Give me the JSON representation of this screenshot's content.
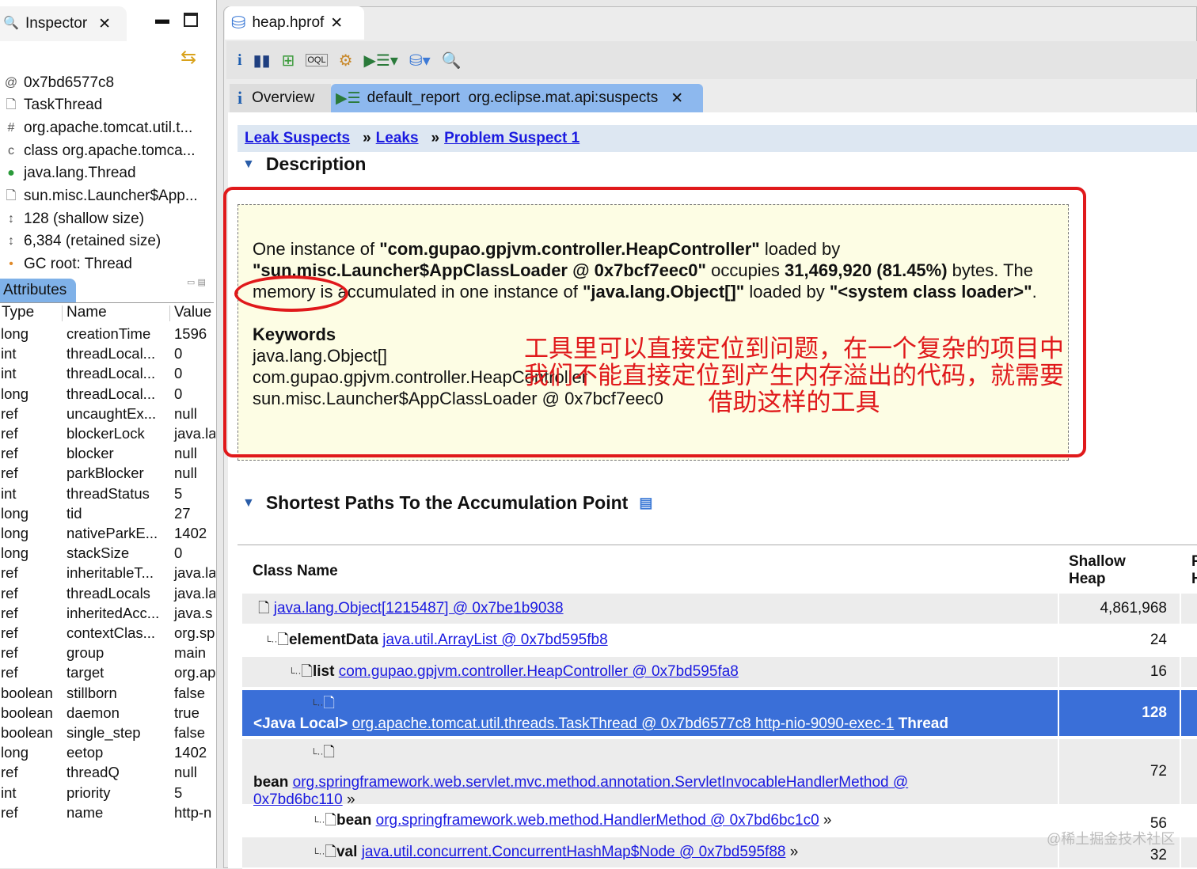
{
  "inspector": {
    "tab_label": "Inspector",
    "items": [
      {
        "icon": "at-icon",
        "text": "0x7bd6577c8"
      },
      {
        "icon": "object-icon",
        "text": "TaskThread"
      },
      {
        "icon": "package-icon",
        "text": "org.apache.tomcat.util.t..."
      },
      {
        "icon": "class-icon",
        "text": "class org.apache.tomca..."
      },
      {
        "icon": "class-static-icon",
        "text": "java.lang.Thread"
      },
      {
        "icon": "classloader-icon",
        "text": "sun.misc.Launcher$App..."
      },
      {
        "icon": "size-icon",
        "text": "128 (shallow size)"
      },
      {
        "icon": "size-icon",
        "text": "6,384 (retained size)"
      },
      {
        "icon": "gc-root-icon",
        "text": "GC root: Thread"
      }
    ],
    "attributes_tab": "Attributes",
    "columns": [
      "Type",
      "Name",
      "Value"
    ],
    "rows": [
      [
        "long",
        "creationTime",
        "1596"
      ],
      [
        "int",
        "threadLocal...",
        "0"
      ],
      [
        "int",
        "threadLocal...",
        "0"
      ],
      [
        "long",
        "threadLocal...",
        "0"
      ],
      [
        "ref",
        "uncaughtEx...",
        "null"
      ],
      [
        "ref",
        "blockerLock",
        "java.la"
      ],
      [
        "ref",
        "blocker",
        "null"
      ],
      [
        "ref",
        "parkBlocker",
        "null"
      ],
      [
        "int",
        "threadStatus",
        "5"
      ],
      [
        "long",
        "tid",
        "27"
      ],
      [
        "long",
        "nativeParkE...",
        "1402"
      ],
      [
        "long",
        "stackSize",
        "0"
      ],
      [
        "ref",
        "inheritableT...",
        "java.la"
      ],
      [
        "ref",
        "threadLocals",
        "java.la"
      ],
      [
        "ref",
        "inheritedAcc...",
        "java.s"
      ],
      [
        "ref",
        "contextClas...",
        "org.sp"
      ],
      [
        "ref",
        "group",
        "main"
      ],
      [
        "ref",
        "target",
        "org.ap"
      ],
      [
        "boolean",
        "stillborn",
        "false"
      ],
      [
        "boolean",
        "daemon",
        "true"
      ],
      [
        "boolean",
        "single_step",
        "false"
      ],
      [
        "long",
        "eetop",
        "1402"
      ],
      [
        "ref",
        "threadQ",
        "null"
      ],
      [
        "int",
        "priority",
        "5"
      ],
      [
        "ref",
        "name",
        "http-n"
      ]
    ]
  },
  "editor": {
    "tab_label": "heap.hprof",
    "subtabs": {
      "overview": "Overview",
      "report": "default_report  org.eclipse.mat.api:suspects"
    },
    "breadcrumb": [
      "Leak Suspects",
      "Leaks",
      "Problem Suspect 1"
    ],
    "breadcrumb_sep": "»",
    "description_heading": "Description",
    "desc": {
      "p1": "One instance of ",
      "cls": "\"com.gupao.gpjvm.controller.HeapController\"",
      "p2": " loaded by ",
      "loader": "\"sun.misc.Launcher$AppClassLoader @ 0x7bcf7eec0\"",
      "p3": " occupies ",
      "bytes": "31,469,920",
      "pct": "(81.45%)",
      "p4": " bytes. The memory is accumulated in one instance of ",
      "arr": "\"java.lang.Object[]\"",
      "p5": " loaded by ",
      "sys": "\"<system class loader>\"",
      "p6": "."
    },
    "keywords_heading": "Keywords",
    "keywords": [
      "java.lang.Object[]",
      "com.gupao.gpjvm.controller.HeapController",
      "sun.misc.Launcher$AppClassLoader @ 0x7bcf7eec0"
    ],
    "annotation": [
      "工具里可以直接定位到问题，在一个复杂的项目中",
      "我们不能直接定位到产生内存溢出的代码，就需要",
      "借助这样的工具"
    ],
    "paths_heading": "Shortest Paths To the Accumulation Point",
    "table": {
      "col_class": "Class Name",
      "col_shallow1": "Shallow",
      "col_shallow2": "Heap",
      "col_r1": "R",
      "col_r2": "H",
      "rows": [
        {
          "prefix": "",
          "link": "java.lang.Object[1215487] @ 0x7be1b9038",
          "suffix": "",
          "shallow": "4,861,968"
        },
        {
          "prefix": "elementData",
          "link": "java.util.ArrayList @ 0x7bd595fb8",
          "suffix": "",
          "shallow": "24"
        },
        {
          "prefix": "list",
          "link": "com.gupao.gpjvm.controller.HeapController @ 0x7bd595fa8",
          "suffix": "",
          "shallow": "16"
        },
        {
          "prefix": "<Java Local>",
          "link": "org.apache.tomcat.util.threads.TaskThread @ 0x7bd6577c8 http-nio-9090-exec-1",
          "suffix": " Thread",
          "shallow": "128"
        },
        {
          "prefix": "bean",
          "link": "org.springframework.web.servlet.mvc.method.annotation.ServletInvocableHandlerMethod @",
          "link2": "0x7bd6bc110",
          "suffix": " »",
          "shallow": "72"
        },
        {
          "prefix": "bean",
          "link": "org.springframework.web.method.HandlerMethod @ 0x7bd6bc1c0",
          "suffix": " »",
          "shallow": "56"
        },
        {
          "prefix": "val",
          "link": "java.util.concurrent.ConcurrentHashMap$Node @ 0x7bd595f88",
          "suffix": " »",
          "shallow": "32"
        }
      ]
    }
  },
  "watermark": "@稀土掘金技术社区",
  "colors": {
    "selection": "#3a6fd8",
    "highlight_box": "#fdfde4",
    "annotation_red": "#e0191b",
    "link": "#1a1ae0"
  }
}
